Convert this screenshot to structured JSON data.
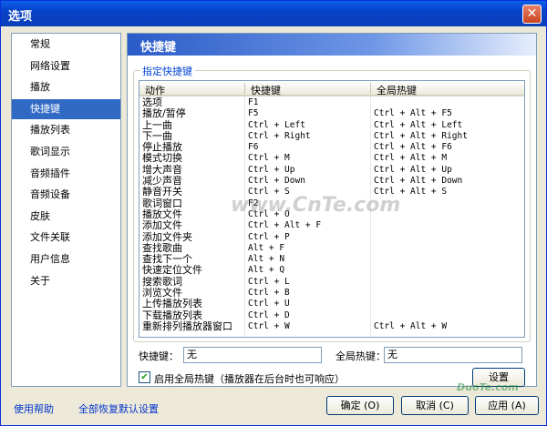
{
  "window": {
    "title": "选项",
    "close_glyph": "✕"
  },
  "sidebar": {
    "items": [
      {
        "label": "常规"
      },
      {
        "label": "网络设置"
      },
      {
        "label": "播放"
      },
      {
        "label": "快捷键",
        "active": true
      },
      {
        "label": "播放列表"
      },
      {
        "label": "歌词显示"
      },
      {
        "label": "音频插件"
      },
      {
        "label": "音频设备"
      },
      {
        "label": "皮肤"
      },
      {
        "label": "文件关联"
      },
      {
        "label": "用户信息"
      },
      {
        "label": "关于"
      }
    ]
  },
  "panel": {
    "title": "快捷键",
    "group_title": "指定快捷键",
    "columns": [
      "动作",
      "快捷键",
      "全局热键"
    ],
    "rows": [
      [
        "选项",
        "F1",
        ""
      ],
      [
        "播放/暂停",
        "F5",
        "Ctrl + Alt + F5"
      ],
      [
        "上一曲",
        "Ctrl + Left",
        "Ctrl + Alt + Left"
      ],
      [
        "下一曲",
        "Ctrl + Right",
        "Ctrl + Alt + Right"
      ],
      [
        "停止播放",
        "F6",
        "Ctrl + Alt + F6"
      ],
      [
        "模式切换",
        "Ctrl + M",
        "Ctrl + Alt + M"
      ],
      [
        "增大声音",
        "Ctrl + Up",
        "Ctrl + Alt + Up"
      ],
      [
        "减少声音",
        "Ctrl + Down",
        "Ctrl + Alt + Down"
      ],
      [
        "静音开关",
        "Ctrl + S",
        "Ctrl + Alt + S"
      ],
      [
        "歌词窗口",
        "F2",
        ""
      ],
      [
        "播放文件",
        "Ctrl + O",
        ""
      ],
      [
        "添加文件",
        "Ctrl + Alt + F",
        ""
      ],
      [
        "添加文件夹",
        "Ctrl + P",
        ""
      ],
      [
        "查找歌曲",
        "Alt + F",
        ""
      ],
      [
        "查找下一个",
        "Alt + N",
        ""
      ],
      [
        "快速定位文件",
        "Alt + Q",
        ""
      ],
      [
        "搜索歌词",
        "Ctrl + L",
        ""
      ],
      [
        "浏览文件",
        "Ctrl + B",
        ""
      ],
      [
        "上传播放列表",
        "Ctrl + U",
        ""
      ],
      [
        "下载播放列表",
        "Ctrl + D",
        ""
      ],
      [
        "重新排列播放器窗口",
        "Ctrl + W",
        "Ctrl + Alt + W"
      ]
    ],
    "shortcut_label": "快捷键：",
    "shortcut_value": "无",
    "hotkey_label": "全局热键：",
    "hotkey_value": "无",
    "enable_hotkey_label": "启用全局热键（播放器在后台时也可响应）",
    "enable_hotkey_checked": true,
    "settings_button": "设置"
  },
  "footer": {
    "help_link": "使用帮助",
    "restore_link": "全部恢复默认设置",
    "ok_button": "确定 (O)",
    "cancel_button": "取消 (C)",
    "apply_button": "应用 (A)"
  },
  "watermarks": {
    "center": "www.CnTe.com",
    "corner": "DuoTe.com"
  }
}
